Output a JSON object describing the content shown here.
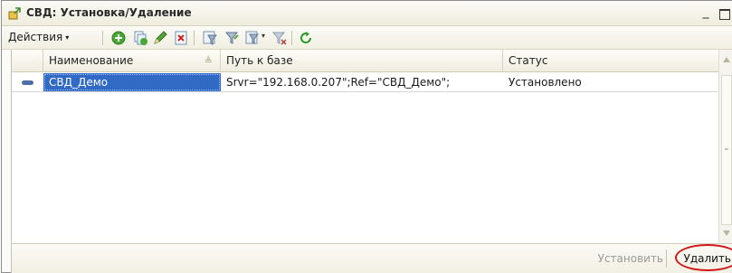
{
  "window": {
    "title": "СВД: Установка/Удаление",
    "minimize_symbol": "_"
  },
  "toolbar": {
    "actions_label": "Действия",
    "actions_caret": "▾",
    "icons": [
      "add-icon",
      "copy-icon",
      "edit-icon",
      "delete-icon",
      "filter-icon",
      "filter-value-icon",
      "filter-list-icon",
      "clear-filter-icon",
      "refresh-icon"
    ]
  },
  "table": {
    "columns": [
      "Наименование",
      "Путь к базе",
      "Статус"
    ],
    "sort_indicator": "≜",
    "rows": [
      {
        "name": "СВД_Демо",
        "path": "Srvr=\"192.168.0.207\";Ref=\"СВД_Демо\";",
        "status": "Установлено"
      }
    ]
  },
  "footer": {
    "install_label": "Установить",
    "delete_label": "Удалить"
  },
  "colors": {
    "selection": "#316ac5",
    "highlight_circle": "#d01818",
    "disabled_text": "#9a9a9a"
  }
}
